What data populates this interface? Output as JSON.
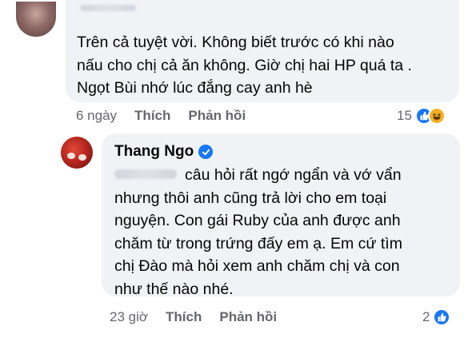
{
  "comment_1": {
    "text_lines": [
      "Trên cả tuyệt vời. Không biết trước có khi nào",
      "nấu cho chị cả ăn không. Giờ chị hai HP quá ta .",
      "Ngọt Bùi nhớ lúc đắng cay anh hè"
    ],
    "time": "6 ngày",
    "like_label": "Thích",
    "reply_label": "Phản hồi",
    "reaction_count": "15",
    "reaction_icons": [
      "like-icon",
      "haha-icon"
    ]
  },
  "reply_1": {
    "author": "Thang Ngo",
    "verified_icon": "verified-badge-icon",
    "text_lines": [
      "câu hỏi rất ngớ ngẩn và vớ vẩn",
      "nhưng thôi anh cũng trả lời cho em toại",
      "nguyện. Con gái Ruby của anh được anh",
      "chăm từ trong trứng đấy em ạ. Em cứ tìm",
      "chị Đào mà hỏi xem anh chăm chị và con",
      "như thế nào nhé."
    ],
    "time": "23 giờ",
    "like_label": "Thích",
    "reply_label": "Phản hồi",
    "reaction_count": "2",
    "reaction_icons": [
      "like-icon"
    ]
  },
  "colors": {
    "bubble": "#f0f2f5",
    "meta_text": "#65676b",
    "like_blue": "#1877f2",
    "haha_yellow": "#f7b125"
  }
}
